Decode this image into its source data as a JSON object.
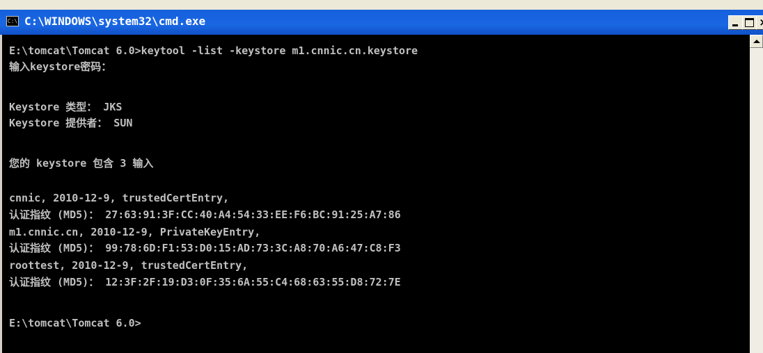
{
  "window": {
    "title": "C:\\WINDOWS\\system32\\cmd.exe",
    "icon_name": "cmd-console-icon",
    "icon_glyph": "C:\\",
    "buttons": {
      "minimize_icon": "minimize-icon",
      "maximize_icon": "maximize-icon",
      "close_icon": "close-icon",
      "close_glyph": "×"
    }
  },
  "colors": {
    "titlebar": "#1560dc",
    "console_bg": "#000000",
    "console_text": "#c0c0c0"
  },
  "console": {
    "lines": [
      "E:\\tomcat\\Tomcat 6.0>keytool -list -keystore m1.cnnic.cn.keystore",
      "输入keystore密码：",
      "",
      "Keystore 类型： JKS",
      "Keystore 提供者： SUN",
      "",
      "您的 keystore 包含 3 输入",
      "",
      "cnnic, 2010-12-9, trustedCertEntry,",
      "认证指纹 (MD5)： 27:63:91:3F:CC:40:A4:54:33:EE:F6:BC:91:25:A7:86",
      "m1.cnnic.cn, 2010-12-9, PrivateKeyEntry,",
      "认证指纹 (MD5)： 99:78:6D:F1:53:D0:15:AD:73:3C:A8:70:A6:47:C8:F3",
      "roottest, 2010-12-9, trustedCertEntry,",
      "认证指纹 (MD5)： 12:3F:2F:19:D3:0F:35:6A:55:C4:68:63:55:D8:72:7E",
      "",
      "E:\\tomcat\\Tomcat 6.0>"
    ]
  },
  "scrollbar": {
    "up_icon": "scroll-up-arrow-icon"
  }
}
